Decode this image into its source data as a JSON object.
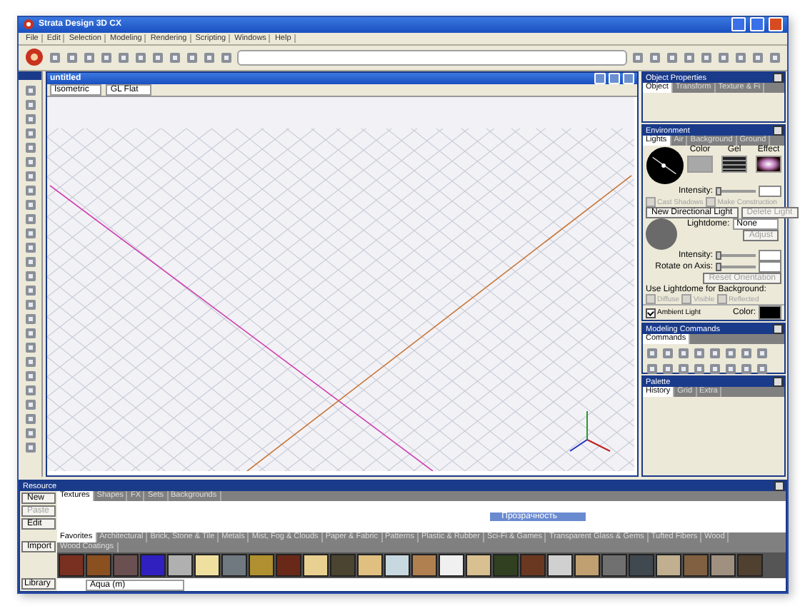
{
  "window": {
    "title": "Strata Design 3D CX"
  },
  "menu": [
    "File",
    "Edit",
    "Selection",
    "Modeling",
    "Rendering",
    "Scripting",
    "Windows",
    "Help"
  ],
  "viewport": {
    "title": "untitled",
    "view": "Isometric",
    "render": "GL Flat"
  },
  "object_properties": {
    "title": "Object Properties",
    "tabs": [
      {
        "label": "Object",
        "selected": true
      },
      {
        "label": "Transform",
        "selected": false
      },
      {
        "label": "Texture & Fi",
        "selected": false
      }
    ]
  },
  "environment": {
    "title": "Environment",
    "tabs": [
      {
        "label": "Lights",
        "selected": true
      },
      {
        "label": "Air",
        "selected": false
      },
      {
        "label": "Background",
        "selected": false
      },
      {
        "label": "Ground",
        "selected": false
      }
    ],
    "swatch_labels": [
      "Color",
      "Gel",
      "Effect"
    ],
    "intensity_label": "Intensity:",
    "intensity_slider": {
      "level": 0
    },
    "checks1": [
      {
        "label": "Cast Shadows",
        "checked": false,
        "disabled": true
      },
      {
        "label": "Make Construction",
        "checked": false,
        "disabled": true
      }
    ],
    "buttons1": [
      {
        "label": "New Directional Light",
        "disabled": false
      },
      {
        "label": "Delete Light",
        "disabled": true
      }
    ],
    "lightdome_label": "Lightdome:",
    "lightdome_value": "None",
    "adjust": {
      "label": "Adjust",
      "disabled": true
    },
    "intensity2_label": "Intensity:",
    "intensity2_slider": {
      "level": 0
    },
    "rotate_label": "Rotate on Axis:",
    "rotate_slider": {
      "level": 0
    },
    "reset": {
      "label": "Reset Orientation",
      "disabled": true
    },
    "background_label": "Use Lightdome for Background:",
    "checks2": [
      {
        "label": "Diffuse",
        "checked": false,
        "disabled": true
      },
      {
        "label": "Visible",
        "checked": false,
        "disabled": true
      },
      {
        "label": "Reflected",
        "checked": false,
        "disabled": true
      }
    ],
    "ambient": {
      "label": "Ambient Light",
      "checked": true
    },
    "color_label": "Color:"
  },
  "modeling": {
    "title": "Modeling Commands",
    "tabs": [
      {
        "label": "Commands",
        "selected": true
      }
    ]
  },
  "palette": {
    "title": "Palette",
    "tabs": [
      {
        "label": "History",
        "selected": true
      },
      {
        "label": "Grid",
        "selected": false
      },
      {
        "label": "Extra",
        "selected": false
      }
    ]
  },
  "resource": {
    "title": "Resource",
    "new": "New",
    "paste": {
      "label": "Paste",
      "disabled": true
    },
    "edit": "Edit",
    "import": "Import",
    "library": "Library",
    "tabs": [
      {
        "label": "Textures",
        "selected": true
      },
      {
        "label": "Shapes",
        "selected": false
      },
      {
        "label": "FX",
        "selected": false
      },
      {
        "label": "Sets",
        "selected": false
      },
      {
        "label": "Backgrounds",
        "selected": false
      }
    ],
    "item": "Прозрачность",
    "categories": [
      {
        "label": "Favorites",
        "selected": true
      },
      {
        "label": "Architectural",
        "selected": false
      },
      {
        "label": "Brick, Stone & Tile",
        "selected": false
      },
      {
        "label": "Metals",
        "selected": false
      },
      {
        "label": "Mist, Fog & Clouds",
        "selected": false
      },
      {
        "label": "Paper & Fabric",
        "selected": false
      },
      {
        "label": "Patterns",
        "selected": false
      },
      {
        "label": "Plastic & Rubber",
        "selected": false
      },
      {
        "label": "Sci-Fi & Games",
        "selected": false
      },
      {
        "label": "Transparent Glass & Gems",
        "selected": false
      },
      {
        "label": "Tufted Fibers",
        "selected": false
      },
      {
        "label": "Wood",
        "selected": false
      },
      {
        "label": "Wood Coatings",
        "selected": false
      }
    ],
    "texture_name": "Aqua (m)"
  }
}
